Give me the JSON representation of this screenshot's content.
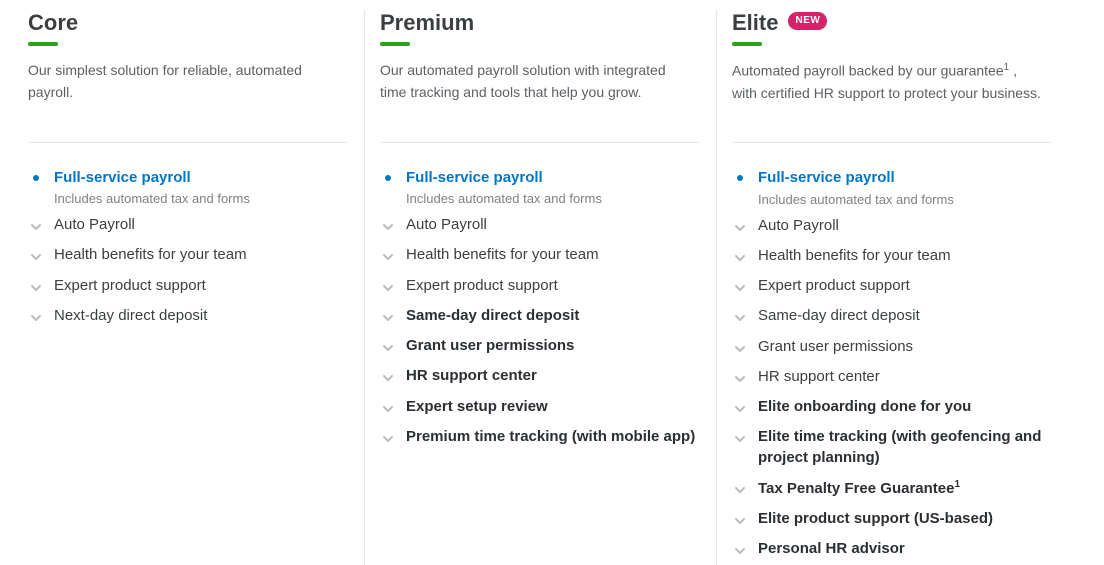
{
  "badge_new": "NEW",
  "plans": [
    {
      "id": "core",
      "title": "Core",
      "description": "Our simplest solution for reliable, automated payroll.",
      "features": [
        {
          "icon": "dot",
          "text": "Full-service payroll",
          "style": "link",
          "sub": "Includes automated tax and forms"
        },
        {
          "icon": "chev",
          "text": "Auto Payroll"
        },
        {
          "icon": "chev",
          "text": "Health benefits for your team"
        },
        {
          "icon": "chev",
          "text": "Expert product support"
        },
        {
          "icon": "chev",
          "text": "Next-day direct deposit"
        }
      ]
    },
    {
      "id": "premium",
      "title": "Premium",
      "description": "Our automated payroll solution with integrated time tracking and tools that help you grow.",
      "features": [
        {
          "icon": "dot",
          "text": "Full-service payroll",
          "style": "link",
          "sub": "Includes automated tax and forms"
        },
        {
          "icon": "chev",
          "text": "Auto Payroll"
        },
        {
          "icon": "chev",
          "text": "Health benefits for your team"
        },
        {
          "icon": "chev",
          "text": "Expert product support"
        },
        {
          "icon": "chev",
          "text": "Same-day direct deposit",
          "style": "bold"
        },
        {
          "icon": "chev",
          "text": "Grant user permissions",
          "style": "bold"
        },
        {
          "icon": "chev",
          "text": "HR support center",
          "style": "bold"
        },
        {
          "icon": "chev",
          "text": "Expert setup review",
          "style": "bold"
        },
        {
          "icon": "chev",
          "text": "Premium time tracking (with mobile app)",
          "style": "bold"
        }
      ]
    },
    {
      "id": "elite",
      "title": "Elite",
      "badge": true,
      "description_html": "Automated payroll backed by our guarantee<sup>1</sup> , with certified HR support to protect your business.",
      "features": [
        {
          "icon": "dot",
          "text": "Full-service payroll",
          "style": "link",
          "sub": "Includes automated tax and forms"
        },
        {
          "icon": "chev",
          "text": "Auto Payroll"
        },
        {
          "icon": "chev",
          "text": "Health benefits for your team"
        },
        {
          "icon": "chev",
          "text": "Expert product support"
        },
        {
          "icon": "chev",
          "text": "Same-day direct deposit"
        },
        {
          "icon": "chev",
          "text": "Grant user permissions"
        },
        {
          "icon": "chev",
          "text": "HR support center"
        },
        {
          "icon": "chev",
          "text": "Elite onboarding done for you",
          "style": "bold"
        },
        {
          "icon": "chev",
          "text": "Elite time tracking (with geofencing and project planning)",
          "style": "bold"
        },
        {
          "icon": "chev",
          "text_html": "Tax Penalty Free Guarantee<sup>1</sup>",
          "style": "bold"
        },
        {
          "icon": "chev",
          "text": "Elite product support (US-based)",
          "style": "bold"
        },
        {
          "icon": "chev",
          "text": "Personal HR advisor",
          "style": "bold"
        }
      ]
    }
  ]
}
